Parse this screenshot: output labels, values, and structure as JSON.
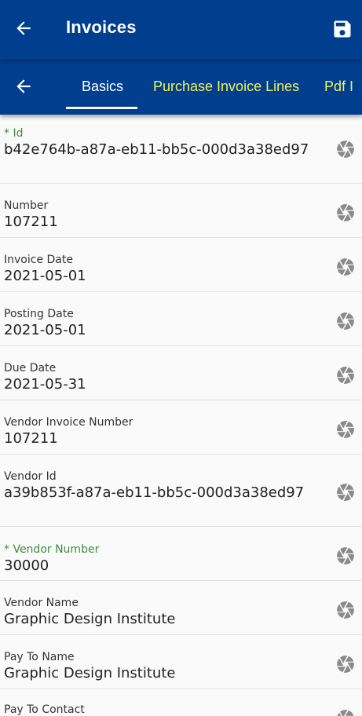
{
  "header": {
    "title": "Invoices"
  },
  "tabs": [
    {
      "label": "Basics"
    },
    {
      "label": "Purchase Invoice Lines"
    },
    {
      "label": "Pdf I"
    }
  ],
  "fields": [
    {
      "label": "* Id",
      "value": "b42e764b-a87a-eb11-bb5c-000d3a38ed97",
      "required": true
    },
    {
      "label": "Number",
      "value": "107211",
      "required": false
    },
    {
      "label": "Invoice Date",
      "value": "2021-05-01",
      "required": false
    },
    {
      "label": "Posting Date",
      "value": "2021-05-01",
      "required": false
    },
    {
      "label": "Due Date",
      "value": "2021-05-31",
      "required": false
    },
    {
      "label": "Vendor Invoice Number",
      "value": "107211",
      "required": false
    },
    {
      "label": "Vendor Id",
      "value": "a39b853f-a87a-eb11-bb5c-000d3a38ed97",
      "required": false
    },
    {
      "label": "* Vendor Number",
      "value": "30000",
      "required": true
    },
    {
      "label": "Vendor Name",
      "value": "Graphic Design Institute",
      "required": false
    },
    {
      "label": "Pay To Name",
      "value": "Graphic Design Institute",
      "required": false
    },
    {
      "label": "Pay To Contact",
      "value": "",
      "required": false
    }
  ],
  "icons": {
    "back": "arrow-left-icon",
    "save": "save-icon",
    "field_action": "camera-shutter-icon"
  },
  "colors": {
    "header_bg": "#003e8f",
    "active_tab": "#ffffff",
    "inactive_tab": "#f2f25a",
    "required_label": "#3d8d3d",
    "field_icon": "#8a8a8a"
  }
}
